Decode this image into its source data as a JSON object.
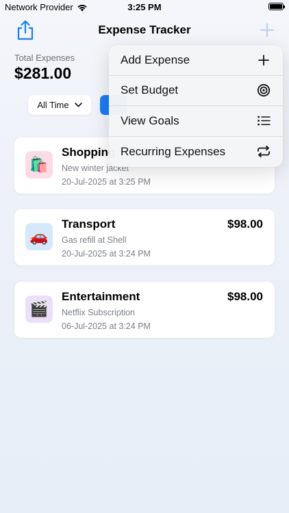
{
  "status_bar": {
    "carrier": "Network Provider",
    "time": "3:25 PM"
  },
  "header": {
    "title": "Expense Tracker"
  },
  "summary": {
    "label": "Total Expenses",
    "amount": "$281.00"
  },
  "filter": {
    "selected": "All Time"
  },
  "expenses": [
    {
      "category": "Shopping",
      "amount": "",
      "description": "New winter jacket",
      "date": "20-Jul-2025 at 3:25 PM",
      "icon": "shopping-bags-icon",
      "icon_glyph": "🛍️",
      "icon_bg": "#fbdce4"
    },
    {
      "category": "Transport",
      "amount": "$98.00",
      "description": "Gas refill at Shell",
      "date": "20-Jul-2025 at 3:24 PM",
      "icon": "car-icon",
      "icon_glyph": "🚗",
      "icon_bg": "#d6e8fb"
    },
    {
      "category": "Entertainment",
      "amount": "$98.00",
      "description": "Netflix Subscription",
      "date": "06-Jul-2025 at 3:24 PM",
      "icon": "clapper-board-icon",
      "icon_glyph": "🎬",
      "icon_bg": "#ece0f8"
    }
  ],
  "menu": {
    "items": [
      {
        "label": "Add Expense",
        "icon": "plus-icon"
      },
      {
        "label": "Set Budget",
        "icon": "target-icon"
      },
      {
        "label": "View Goals",
        "icon": "list-icon"
      },
      {
        "label": "Recurring Expenses",
        "icon": "repeat-icon"
      }
    ]
  },
  "colors": {
    "accent": "#1a7cf4"
  }
}
